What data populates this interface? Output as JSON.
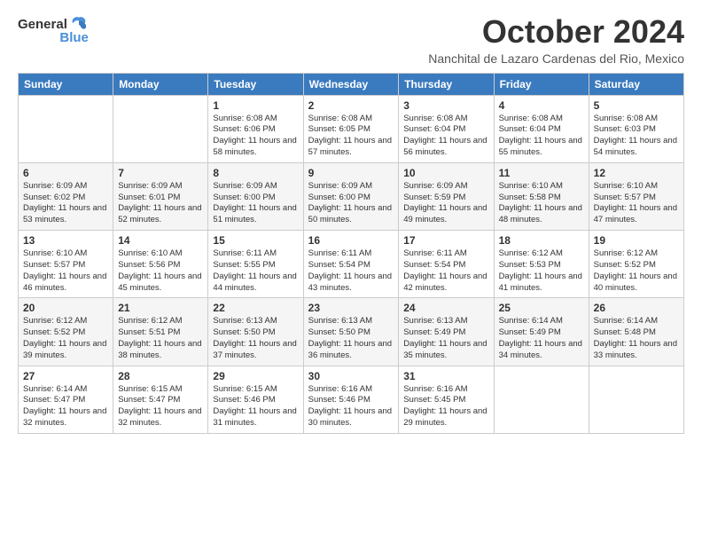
{
  "logo": {
    "text_general": "General",
    "text_blue": "Blue"
  },
  "title": "October 2024",
  "subtitle": "Nanchital de Lazaro Cardenas del Rio, Mexico",
  "days_of_week": [
    "Sunday",
    "Monday",
    "Tuesday",
    "Wednesday",
    "Thursday",
    "Friday",
    "Saturday"
  ],
  "weeks": [
    [
      {
        "day": "",
        "info": ""
      },
      {
        "day": "",
        "info": ""
      },
      {
        "day": "1",
        "info": "Sunrise: 6:08 AM\nSunset: 6:06 PM\nDaylight: 11 hours and 58 minutes."
      },
      {
        "day": "2",
        "info": "Sunrise: 6:08 AM\nSunset: 6:05 PM\nDaylight: 11 hours and 57 minutes."
      },
      {
        "day": "3",
        "info": "Sunrise: 6:08 AM\nSunset: 6:04 PM\nDaylight: 11 hours and 56 minutes."
      },
      {
        "day": "4",
        "info": "Sunrise: 6:08 AM\nSunset: 6:04 PM\nDaylight: 11 hours and 55 minutes."
      },
      {
        "day": "5",
        "info": "Sunrise: 6:08 AM\nSunset: 6:03 PM\nDaylight: 11 hours and 54 minutes."
      }
    ],
    [
      {
        "day": "6",
        "info": "Sunrise: 6:09 AM\nSunset: 6:02 PM\nDaylight: 11 hours and 53 minutes."
      },
      {
        "day": "7",
        "info": "Sunrise: 6:09 AM\nSunset: 6:01 PM\nDaylight: 11 hours and 52 minutes."
      },
      {
        "day": "8",
        "info": "Sunrise: 6:09 AM\nSunset: 6:00 PM\nDaylight: 11 hours and 51 minutes."
      },
      {
        "day": "9",
        "info": "Sunrise: 6:09 AM\nSunset: 6:00 PM\nDaylight: 11 hours and 50 minutes."
      },
      {
        "day": "10",
        "info": "Sunrise: 6:09 AM\nSunset: 5:59 PM\nDaylight: 11 hours and 49 minutes."
      },
      {
        "day": "11",
        "info": "Sunrise: 6:10 AM\nSunset: 5:58 PM\nDaylight: 11 hours and 48 minutes."
      },
      {
        "day": "12",
        "info": "Sunrise: 6:10 AM\nSunset: 5:57 PM\nDaylight: 11 hours and 47 minutes."
      }
    ],
    [
      {
        "day": "13",
        "info": "Sunrise: 6:10 AM\nSunset: 5:57 PM\nDaylight: 11 hours and 46 minutes."
      },
      {
        "day": "14",
        "info": "Sunrise: 6:10 AM\nSunset: 5:56 PM\nDaylight: 11 hours and 45 minutes."
      },
      {
        "day": "15",
        "info": "Sunrise: 6:11 AM\nSunset: 5:55 PM\nDaylight: 11 hours and 44 minutes."
      },
      {
        "day": "16",
        "info": "Sunrise: 6:11 AM\nSunset: 5:54 PM\nDaylight: 11 hours and 43 minutes."
      },
      {
        "day": "17",
        "info": "Sunrise: 6:11 AM\nSunset: 5:54 PM\nDaylight: 11 hours and 42 minutes."
      },
      {
        "day": "18",
        "info": "Sunrise: 6:12 AM\nSunset: 5:53 PM\nDaylight: 11 hours and 41 minutes."
      },
      {
        "day": "19",
        "info": "Sunrise: 6:12 AM\nSunset: 5:52 PM\nDaylight: 11 hours and 40 minutes."
      }
    ],
    [
      {
        "day": "20",
        "info": "Sunrise: 6:12 AM\nSunset: 5:52 PM\nDaylight: 11 hours and 39 minutes."
      },
      {
        "day": "21",
        "info": "Sunrise: 6:12 AM\nSunset: 5:51 PM\nDaylight: 11 hours and 38 minutes."
      },
      {
        "day": "22",
        "info": "Sunrise: 6:13 AM\nSunset: 5:50 PM\nDaylight: 11 hours and 37 minutes."
      },
      {
        "day": "23",
        "info": "Sunrise: 6:13 AM\nSunset: 5:50 PM\nDaylight: 11 hours and 36 minutes."
      },
      {
        "day": "24",
        "info": "Sunrise: 6:13 AM\nSunset: 5:49 PM\nDaylight: 11 hours and 35 minutes."
      },
      {
        "day": "25",
        "info": "Sunrise: 6:14 AM\nSunset: 5:49 PM\nDaylight: 11 hours and 34 minutes."
      },
      {
        "day": "26",
        "info": "Sunrise: 6:14 AM\nSunset: 5:48 PM\nDaylight: 11 hours and 33 minutes."
      }
    ],
    [
      {
        "day": "27",
        "info": "Sunrise: 6:14 AM\nSunset: 5:47 PM\nDaylight: 11 hours and 32 minutes."
      },
      {
        "day": "28",
        "info": "Sunrise: 6:15 AM\nSunset: 5:47 PM\nDaylight: 11 hours and 32 minutes."
      },
      {
        "day": "29",
        "info": "Sunrise: 6:15 AM\nSunset: 5:46 PM\nDaylight: 11 hours and 31 minutes."
      },
      {
        "day": "30",
        "info": "Sunrise: 6:16 AM\nSunset: 5:46 PM\nDaylight: 11 hours and 30 minutes."
      },
      {
        "day": "31",
        "info": "Sunrise: 6:16 AM\nSunset: 5:45 PM\nDaylight: 11 hours and 29 minutes."
      },
      {
        "day": "",
        "info": ""
      },
      {
        "day": "",
        "info": ""
      }
    ]
  ]
}
